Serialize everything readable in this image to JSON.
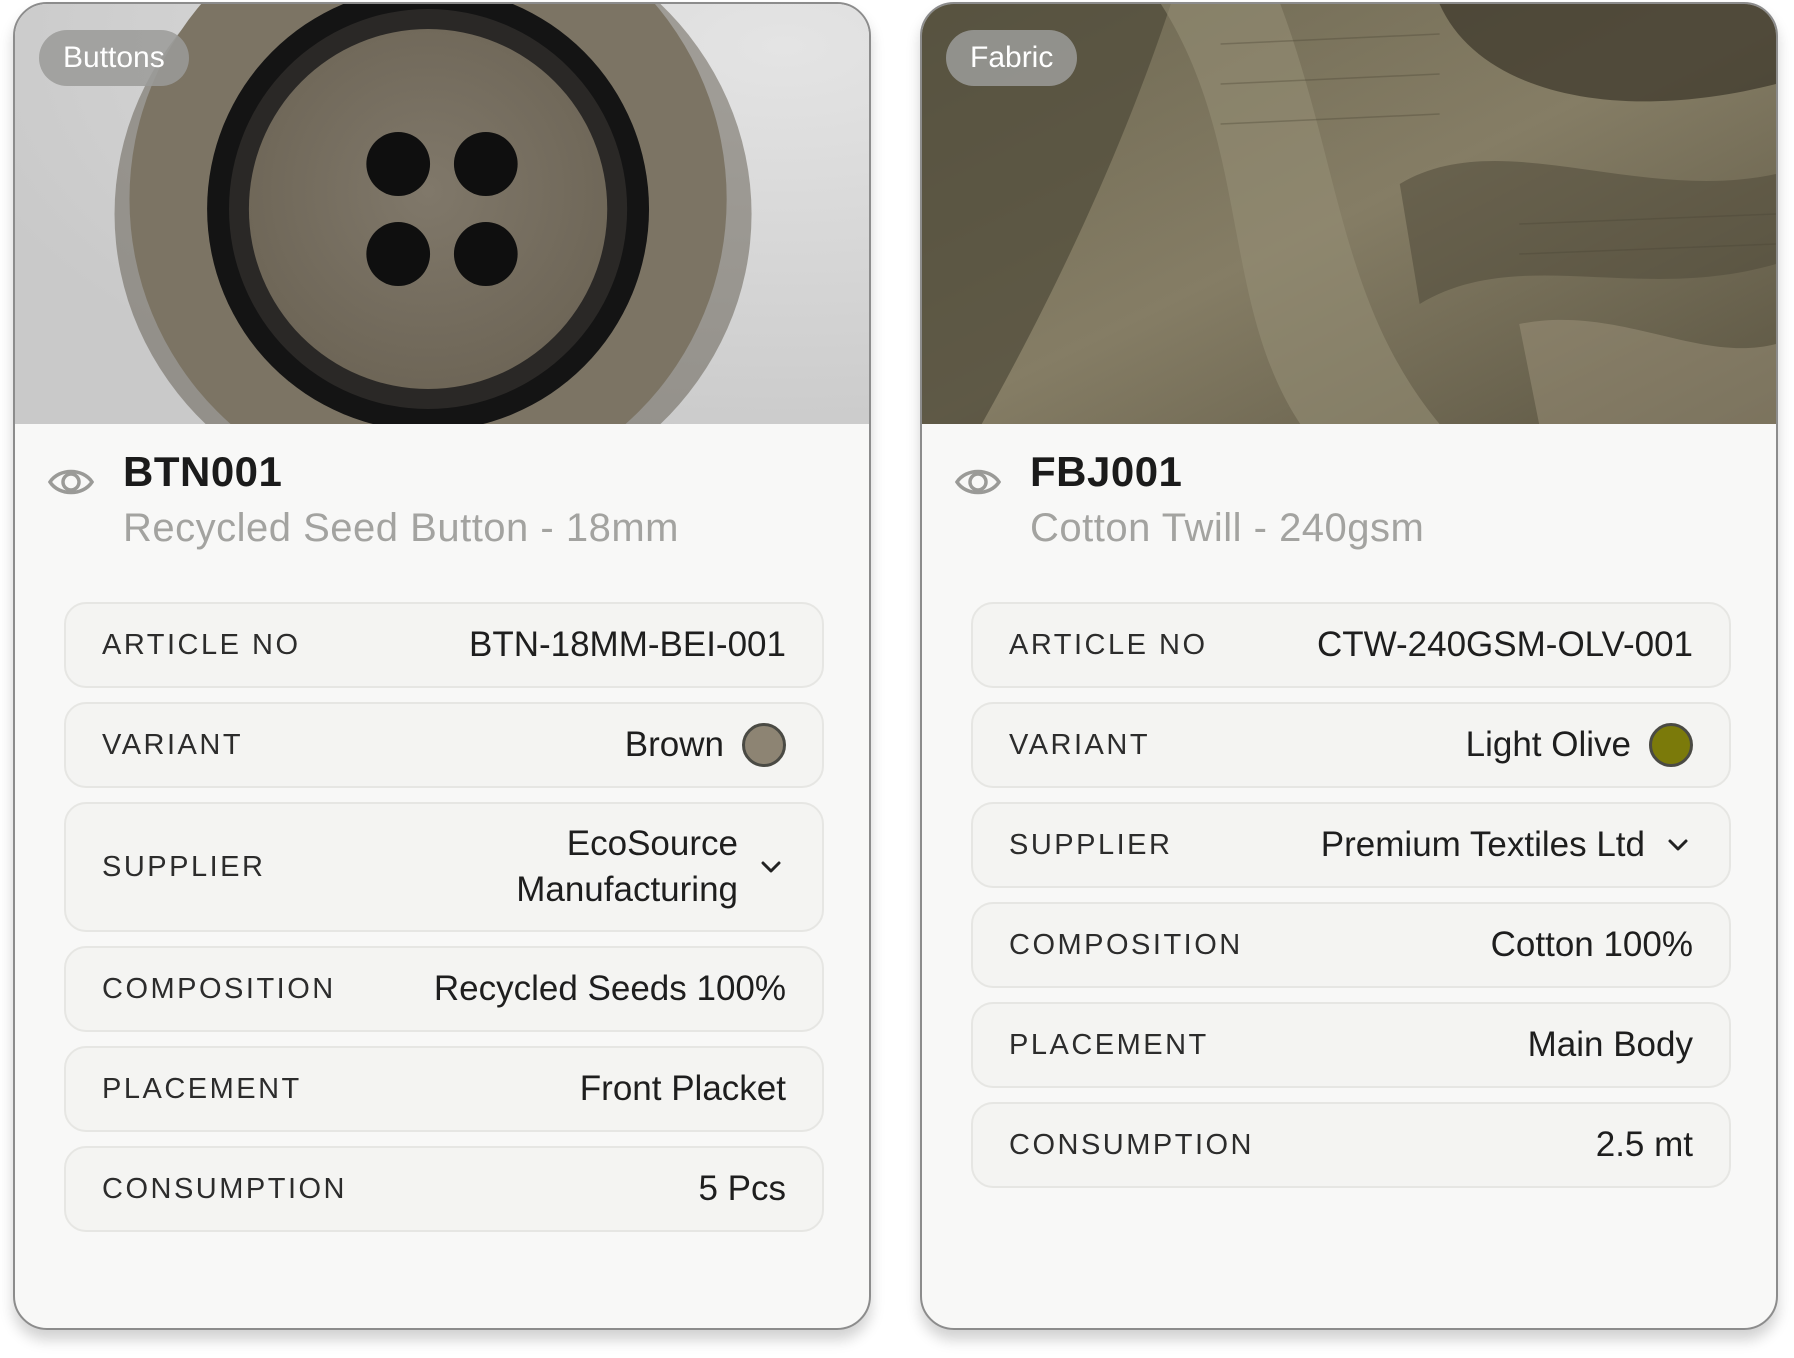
{
  "cards": [
    {
      "category": "Buttons",
      "code": "BTN001",
      "name": "Recycled Seed Button - 18mm",
      "image_icon": "button-photo",
      "fields": {
        "article_no": {
          "label": "ARTICLE NO",
          "value": "BTN-18MM-BEI-001"
        },
        "variant": {
          "label": "VARIANT",
          "value": "Brown",
          "color": "#8d8473"
        },
        "supplier": {
          "label": "SUPPLIER",
          "value": "EcoSource Manufacturing"
        },
        "composition": {
          "label": "COMPOSITION",
          "value": "Recycled Seeds 100%"
        },
        "placement": {
          "label": "PLACEMENT",
          "value": "Front Placket"
        },
        "consumption": {
          "label": "CONSUMPTION",
          "value": "5 Pcs"
        }
      }
    },
    {
      "category": "Fabric",
      "code": "FBJ001",
      "name": "Cotton Twill - 240gsm",
      "image_icon": "fabric-photo",
      "fields": {
        "article_no": {
          "label": "ARTICLE NO",
          "value": "CTW-240GSM-OLV-001"
        },
        "variant": {
          "label": "VARIANT",
          "value": "Light Olive",
          "color": "#7b7a0a"
        },
        "supplier": {
          "label": "SUPPLIER",
          "value": "Premium Textiles Ltd"
        },
        "composition": {
          "label": "COMPOSITION",
          "value": "Cotton 100%"
        },
        "placement": {
          "label": "PLACEMENT",
          "value": "Main Body"
        },
        "consumption": {
          "label": "CONSUMPTION",
          "value": "2.5 mt"
        }
      }
    }
  ],
  "colors": {
    "card_bg": "#f8f8f7",
    "row_bg": "#f4f4f2",
    "subtitle": "#a3a3a0",
    "chip_bg": "#9b9b98"
  }
}
